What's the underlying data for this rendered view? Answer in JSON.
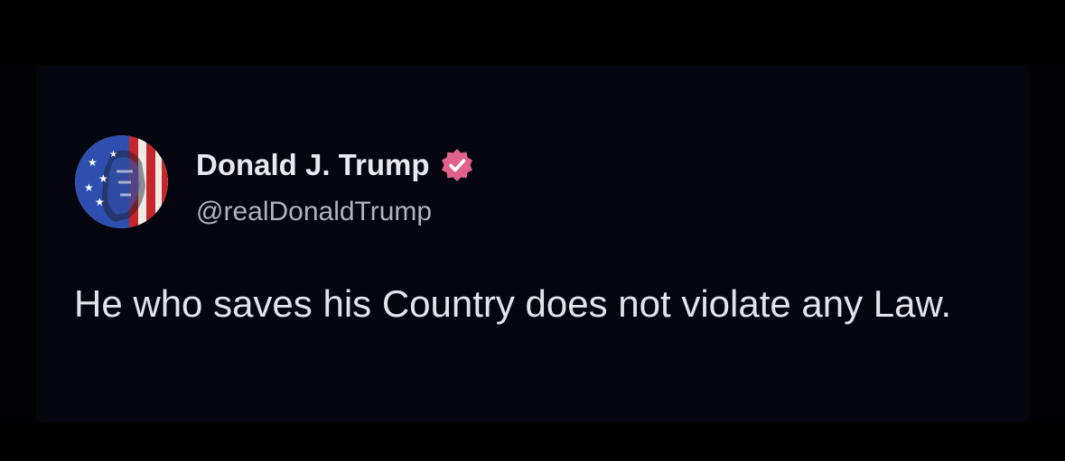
{
  "post": {
    "author": {
      "display_name": "Donald J. Trump",
      "handle": "@realDonaldTrump",
      "verified_icon": "verified-badge-icon",
      "avatar_icon": "flag-portrait-avatar"
    },
    "text": "He who saves his Country does not violate any Law."
  },
  "colors": {
    "background": "#000000",
    "card_background": "#05050f",
    "name_text": "#e8e8ee",
    "handle_text": "#b3b3bd",
    "badge": "#e0628a"
  }
}
